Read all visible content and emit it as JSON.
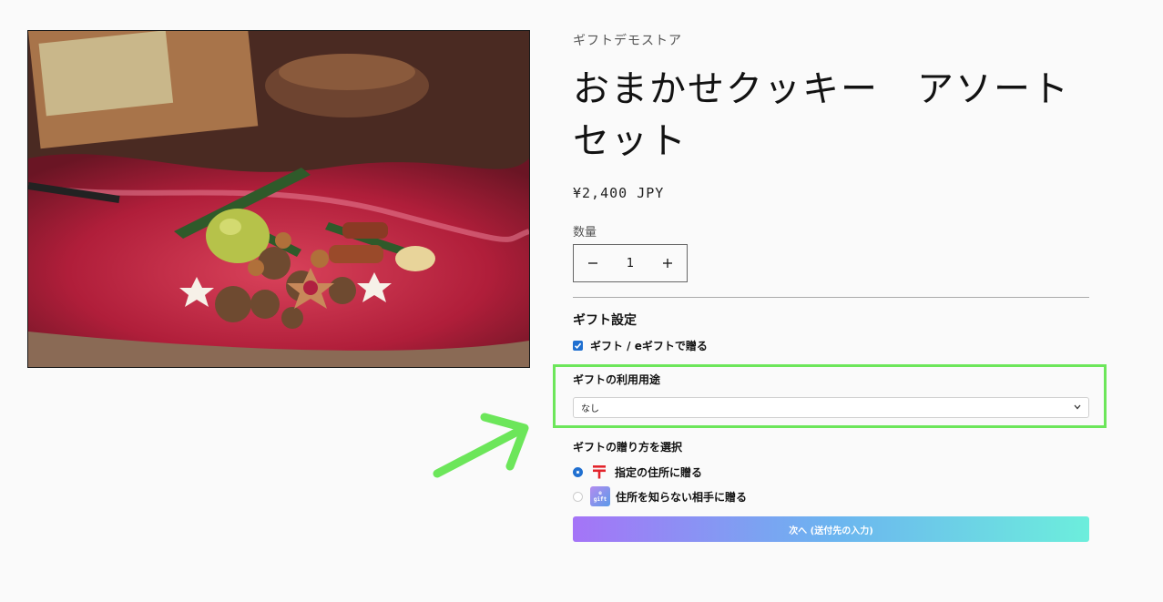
{
  "product": {
    "vendor": "ギフトデモストア",
    "title": "おまかせクッキー　アソートセット",
    "price": "¥2,400 JPY"
  },
  "quantity": {
    "label": "数量",
    "value": "1",
    "minus_icon": "minus-icon",
    "plus_icon": "plus-icon"
  },
  "gift": {
    "heading": "ギフト設定",
    "checkbox_label": "ギフト / eギフトで贈る",
    "checkbox_checked": true,
    "usage_label": "ギフトの利用用途",
    "usage_selected": "なし",
    "method_label": "ギフトの贈り方を選択",
    "options": [
      {
        "label": "指定の住所に贈る",
        "selected": true,
        "icon": "postal-mark-icon"
      },
      {
        "label": "住所を知らない相手に贈る",
        "selected": false,
        "icon": "egift-icon"
      }
    ],
    "egift_icon_text": [
      "e",
      "gift"
    ],
    "next_button": "次へ (送付先の入力)"
  },
  "colors": {
    "accent_blue": "#1f6fd0",
    "highlight_green": "#6ce65a",
    "button_gradient": [
      "#a574f7",
      "#6cb4f0",
      "#6ceedc"
    ],
    "postal_red": "#e3242b"
  }
}
